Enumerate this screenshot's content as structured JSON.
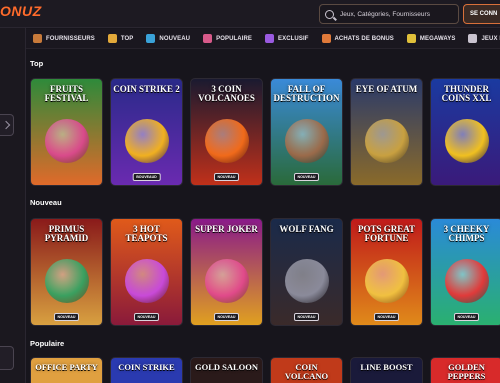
{
  "header": {
    "logo": "ONUZ",
    "search_placeholder": "Jeux, Catégories, Fournisseurs",
    "login_label": "SE CONN"
  },
  "nav": {
    "items": [
      {
        "label": "FOURNISSEURS",
        "icon": "providers-icon",
        "color": "#c87a3a"
      },
      {
        "label": "TOP",
        "icon": "trophy-icon",
        "color": "#e3a93a"
      },
      {
        "label": "NOUVEAU",
        "icon": "planet-icon",
        "color": "#3aa2d8"
      },
      {
        "label": "POPULAIRE",
        "icon": "rocket-icon",
        "color": "#d85a8a"
      },
      {
        "label": "EXCLUSIF",
        "icon": "diamond-icon",
        "color": "#9a5ae0"
      },
      {
        "label": "ACHATS DE BONUS",
        "icon": "rocket-bonus-icon",
        "color": "#e07a3a"
      },
      {
        "label": "MEGAWAYS",
        "icon": "megaways-icon",
        "color": "#e0c03a"
      },
      {
        "label": "JEUX EN LIGNE",
        "icon": "live-icon",
        "color": "#c9c3cf"
      }
    ]
  },
  "sections": {
    "top": {
      "title": "Top",
      "games": [
        {
          "title": "FRUITS FESTIVAL",
          "button": "",
          "bg1": "#2e8a3a",
          "bg2": "#e06a2a",
          "art": "#d84a8a"
        },
        {
          "title": "COIN STRIKE 2",
          "button": "BOUVEAUD",
          "bg1": "#2a2a8a",
          "bg2": "#6a2ab0",
          "art": "#f0b020"
        },
        {
          "title": "3 COIN VOLCANOES",
          "button": "NOUVEAU",
          "bg1": "#1a1a30",
          "bg2": "#c0301a",
          "art": "#f06a1a"
        },
        {
          "title": "FALL OF DESTRUCTION",
          "button": "NOUVEAU",
          "bg1": "#3a8ad8",
          "bg2": "#2a6a3a",
          "art": "#9a6a4a"
        },
        {
          "title": "EYE OF ATUM",
          "button": "",
          "bg1": "#2a3a6a",
          "bg2": "#8a6a2a",
          "art": "#c8a040"
        },
        {
          "title": "THUNDER COINS XXL",
          "button": "",
          "bg1": "#1a3aa0",
          "bg2": "#3a1a7a",
          "art": "#f0c020"
        }
      ]
    },
    "nouveau": {
      "title": "Nouveau",
      "games": [
        {
          "title": "PRIMUS PYRAMID",
          "button": "NOUVEAU",
          "bg1": "#8a1a1a",
          "bg2": "#d8a040",
          "art": "#3aa060"
        },
        {
          "title": "3 HOT TEAPOTS",
          "button": "NOUVEAU",
          "bg1": "#e05a1a",
          "bg2": "#8a1a3a",
          "art": "#c84ad8"
        },
        {
          "title": "SUPER JOKER",
          "button": "NOUVEAU",
          "bg1": "#8a1a8a",
          "bg2": "#e0a020",
          "art": "#e04a8a"
        },
        {
          "title": "WOLF FANG",
          "button": "NOUVEAU",
          "bg1": "#1a2a4a",
          "bg2": "#3a2a2a",
          "art": "#8a8a9a"
        },
        {
          "title": "POTS GREAT FORTUNE",
          "button": "NOUVEAU",
          "bg1": "#c01a1a",
          "bg2": "#e08a1a",
          "art": "#f0c040"
        },
        {
          "title": "3 CHEEKY CHIMPS",
          "button": "NOUVEAU",
          "bg1": "#2a8ad8",
          "bg2": "#2ab070",
          "art": "#e03a3a"
        }
      ]
    },
    "populaire": {
      "title": "Populaire",
      "games": [
        {
          "title": "OFFICE PARTY",
          "bg1": "#e0a040",
          "bg2": "#e0a040"
        },
        {
          "title": "COIN STRIKE",
          "bg1": "#2a3ab0",
          "bg2": "#2a3ab0"
        },
        {
          "title": "GOLD SALOON",
          "bg1": "#2a1a1a",
          "bg2": "#2a1a1a"
        },
        {
          "title": "COIN VOLCANO",
          "bg1": "#c03a1a",
          "bg2": "#c03a1a"
        },
        {
          "title": "LINE BOOST",
          "bg1": "#1a1a3a",
          "bg2": "#1a1a3a"
        },
        {
          "title": "GOLDEN PEPPERS",
          "bg1": "#d82a2a",
          "bg2": "#d82a2a"
        }
      ]
    }
  }
}
